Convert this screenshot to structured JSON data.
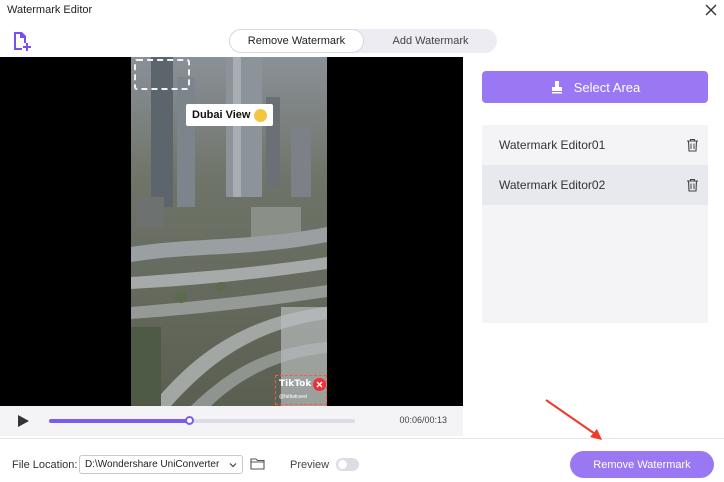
{
  "window": {
    "title": "Watermark Editor"
  },
  "tabs": [
    {
      "label": "Remove Watermark",
      "active": true
    },
    {
      "label": "Add Watermark",
      "active": false
    }
  ],
  "video": {
    "caption": "Dubai View",
    "overlay_logo": "TikTok",
    "overlay_handle": "@fattiatravel"
  },
  "player": {
    "time": "00:06/00:13",
    "progress": 0.46
  },
  "right_panel": {
    "select_area_label": "Select Area",
    "items": [
      {
        "label": "Watermark Editor01",
        "selected": false
      },
      {
        "label": "Watermark Editor02",
        "selected": true
      }
    ]
  },
  "footer": {
    "file_location_label": "File Location:",
    "file_location_value": "D:\\Wondershare UniConverter",
    "preview_label": "Preview",
    "preview_on": false,
    "remove_button_label": "Remove Watermark"
  },
  "colors": {
    "accent": "#9a78f4",
    "progress": "#7a5cf0",
    "annotation_arrow": "#ee3b2b"
  }
}
